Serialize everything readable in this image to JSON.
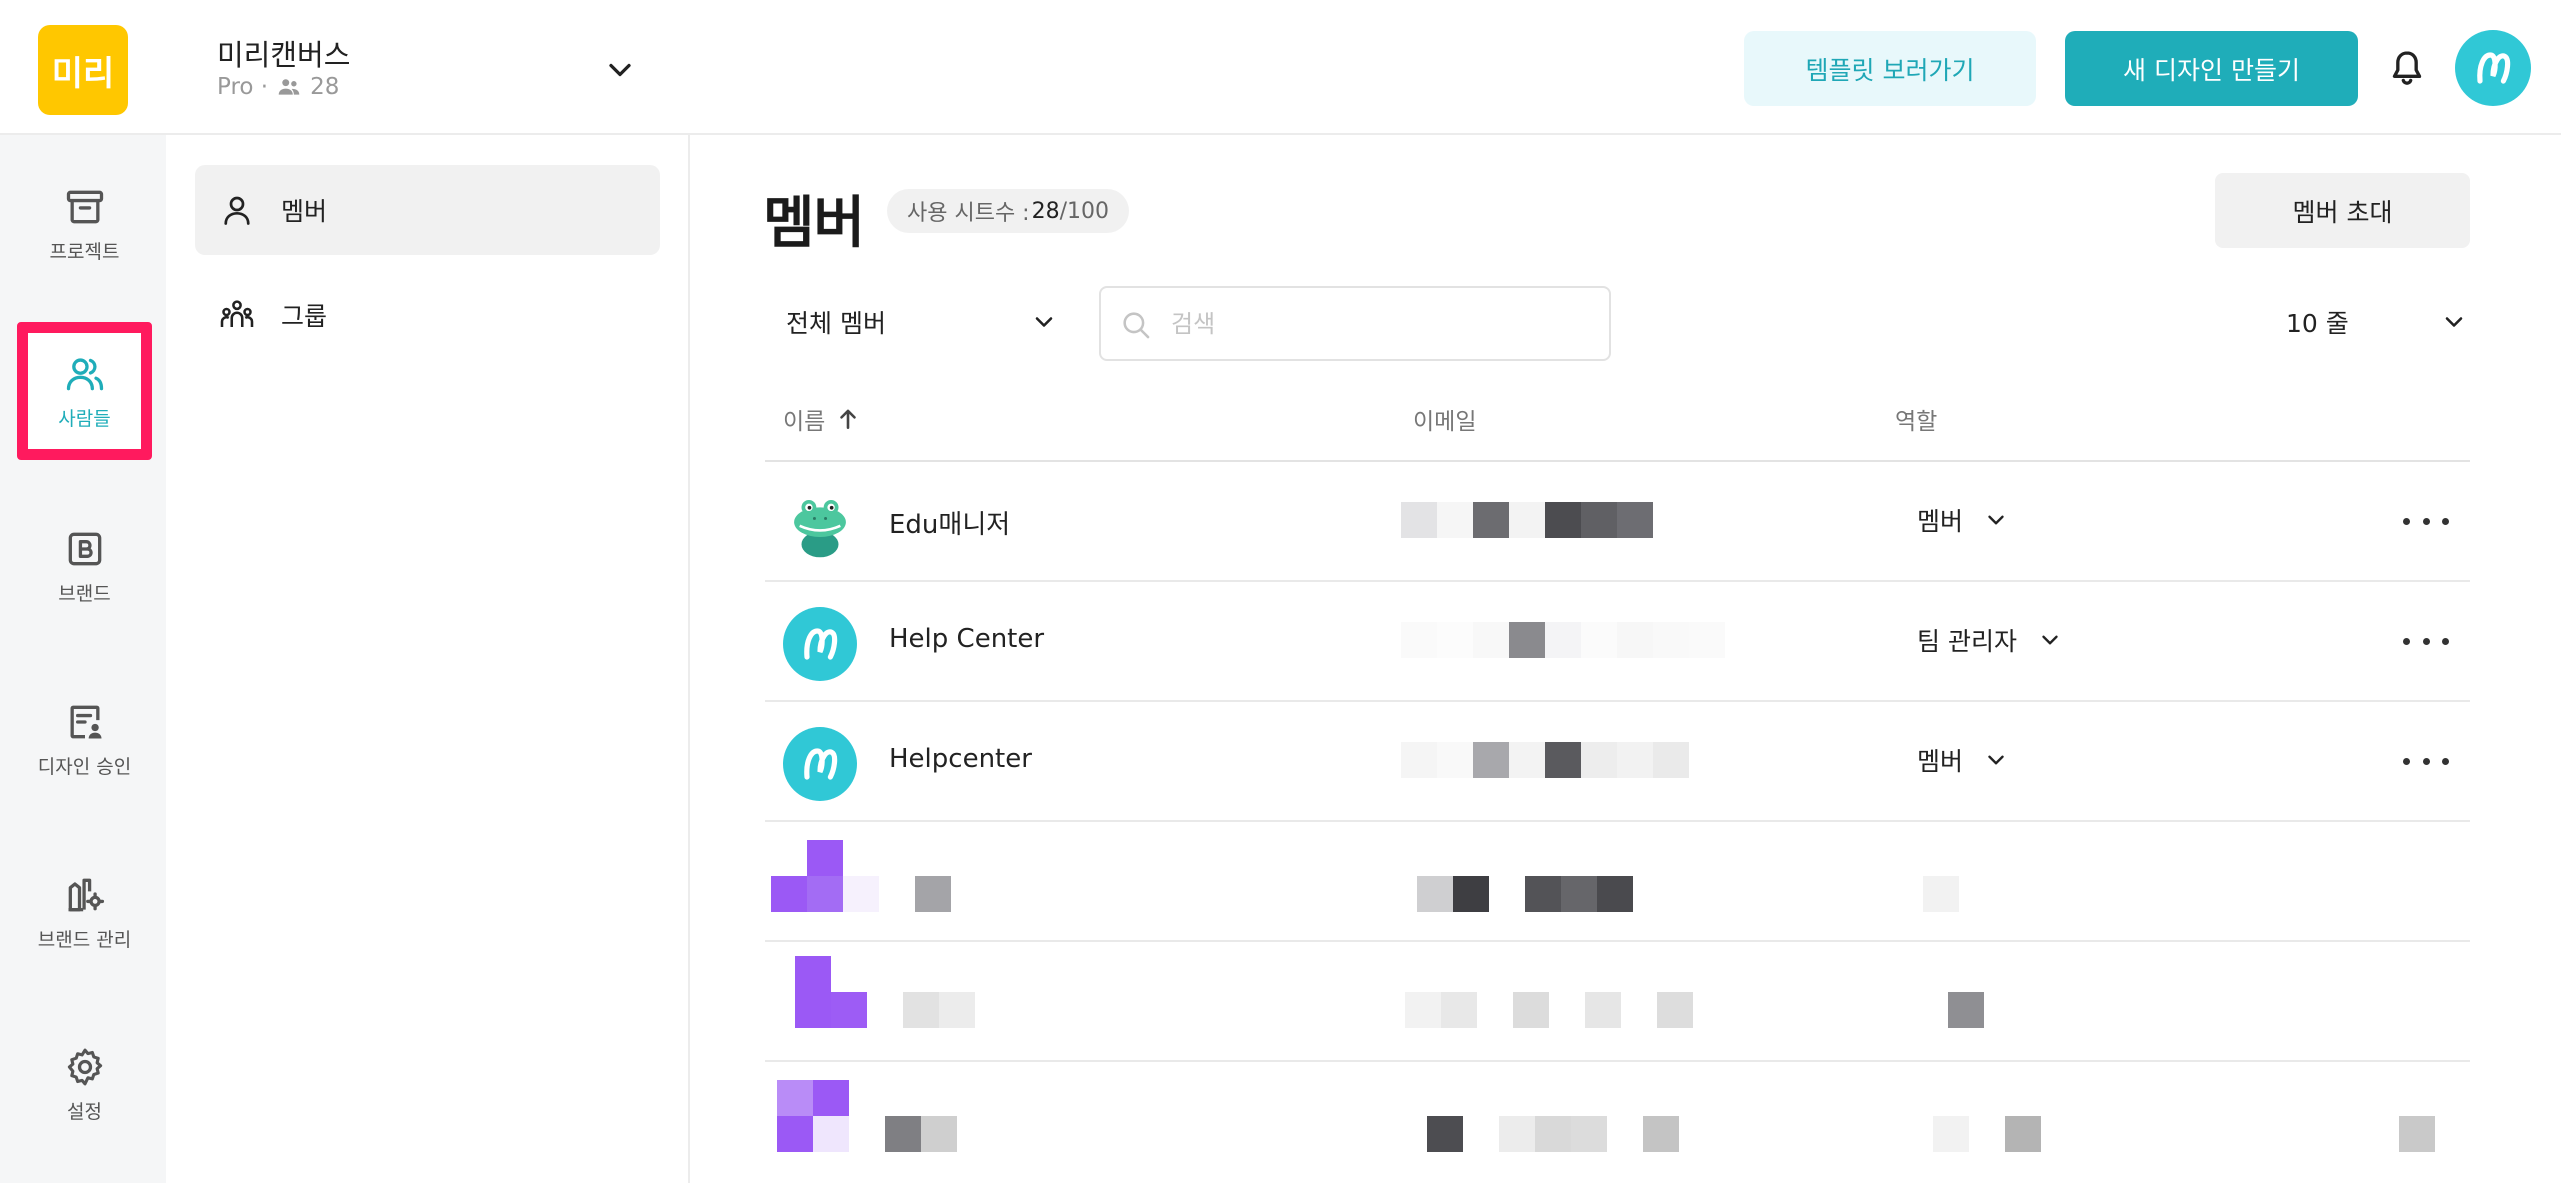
{
  "header": {
    "logo_text": "미리",
    "workspace_name": "미리캔버스",
    "workspace_plan": "Pro ·",
    "member_count": "28",
    "template_button": "템플릿 보러가기",
    "new_design_button": "새 디자인 만들기"
  },
  "rail": {
    "items": [
      {
        "label": "프로젝트",
        "icon": "archive-icon"
      },
      {
        "label": "사람들",
        "icon": "people-icon",
        "active": true
      },
      {
        "label": "브랜드",
        "icon": "brand-icon"
      },
      {
        "label": "디자인 승인",
        "icon": "approval-icon"
      },
      {
        "label": "브랜드 관리",
        "icon": "brand-manage-icon"
      },
      {
        "label": "설정",
        "icon": "gear-icon"
      }
    ]
  },
  "subnav": {
    "items": [
      {
        "label": "멤버",
        "icon": "person-icon",
        "active": true
      },
      {
        "label": "그룹",
        "icon": "group-icon"
      }
    ]
  },
  "main": {
    "title": "멤버",
    "seat_label": "사용 시트수 :",
    "seat_used": "28",
    "seat_total": "/100",
    "invite_button": "멤버 초대",
    "filter_value": "전체 멤버",
    "search_placeholder": "검색",
    "rows_per_page": "10 줄",
    "columns": {
      "name": "이름",
      "email": "이메일",
      "role": "역할"
    },
    "members": [
      {
        "name": "Edu매니저",
        "role": "멤버"
      },
      {
        "name": "Help Center",
        "role": "팀 관리자"
      },
      {
        "name": "Helpcenter",
        "role": "멤버"
      }
    ]
  },
  "colors": {
    "accent": "#1fadb9",
    "logo": "#ffc700",
    "highlight": "#ff1a5e",
    "avatar_purple": "#9b59f5"
  }
}
